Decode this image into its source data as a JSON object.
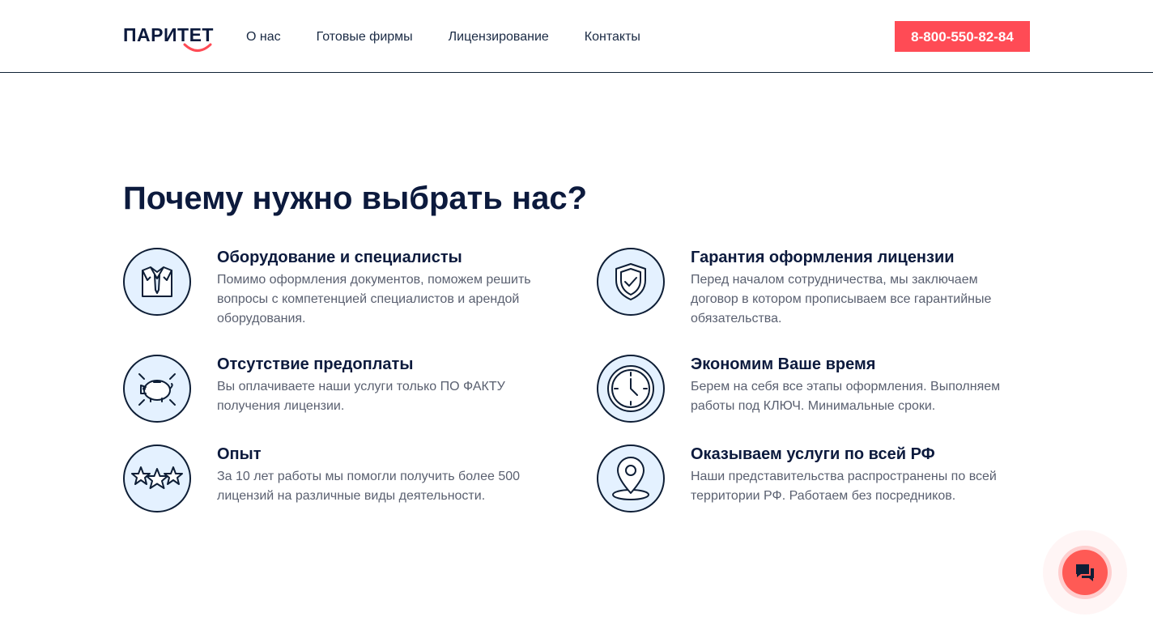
{
  "header": {
    "logo_text": "ПАРИТЕТ",
    "nav": [
      {
        "label": "О нас"
      },
      {
        "label": "Готовые фирмы"
      },
      {
        "label": "Лицензирование"
      },
      {
        "label": "Контакты"
      }
    ],
    "phone": "8-800-550-82-84"
  },
  "main": {
    "title": "Почему нужно выбрать нас?",
    "features": [
      {
        "title": "Оборудование и специалисты",
        "text": "Помимо оформления документов, поможем решить вопросы с компетенцией специалистов и арендой оборудования.",
        "icon": "suit-tie-icon"
      },
      {
        "title": "Гарантия оформления лицензии",
        "text": "Перед началом сотрудничества, мы заключаем договор в котором прописываем все гарантийные обязательства.",
        "icon": "shield-check-icon"
      },
      {
        "title": "Отсутствие предоплаты",
        "text": "Вы оплачиваете наши услуги только ПО ФАКТУ получения лицензии.",
        "icon": "piggy-bank-icon"
      },
      {
        "title": "Экономим Ваше время",
        "text": "Берем на себя все этапы оформления. Выполняем работы под КЛЮЧ. Минимальные сроки.",
        "icon": "clock-icon"
      },
      {
        "title": "Опыт",
        "text": "За 10 лет работы мы помогли получить более 500 лицензий на различные виды деятельности.",
        "icon": "stars-icon"
      },
      {
        "title": "Оказываем услуги по всей РФ",
        "text": "Наши представительства распространены по всей территории РФ. Работаем без посредников.",
        "icon": "map-pin-icon"
      }
    ]
  },
  "colors": {
    "accent": "#ff4b55",
    "dark": "#0c1a3d",
    "icon_bg": "#e4f1ff"
  }
}
